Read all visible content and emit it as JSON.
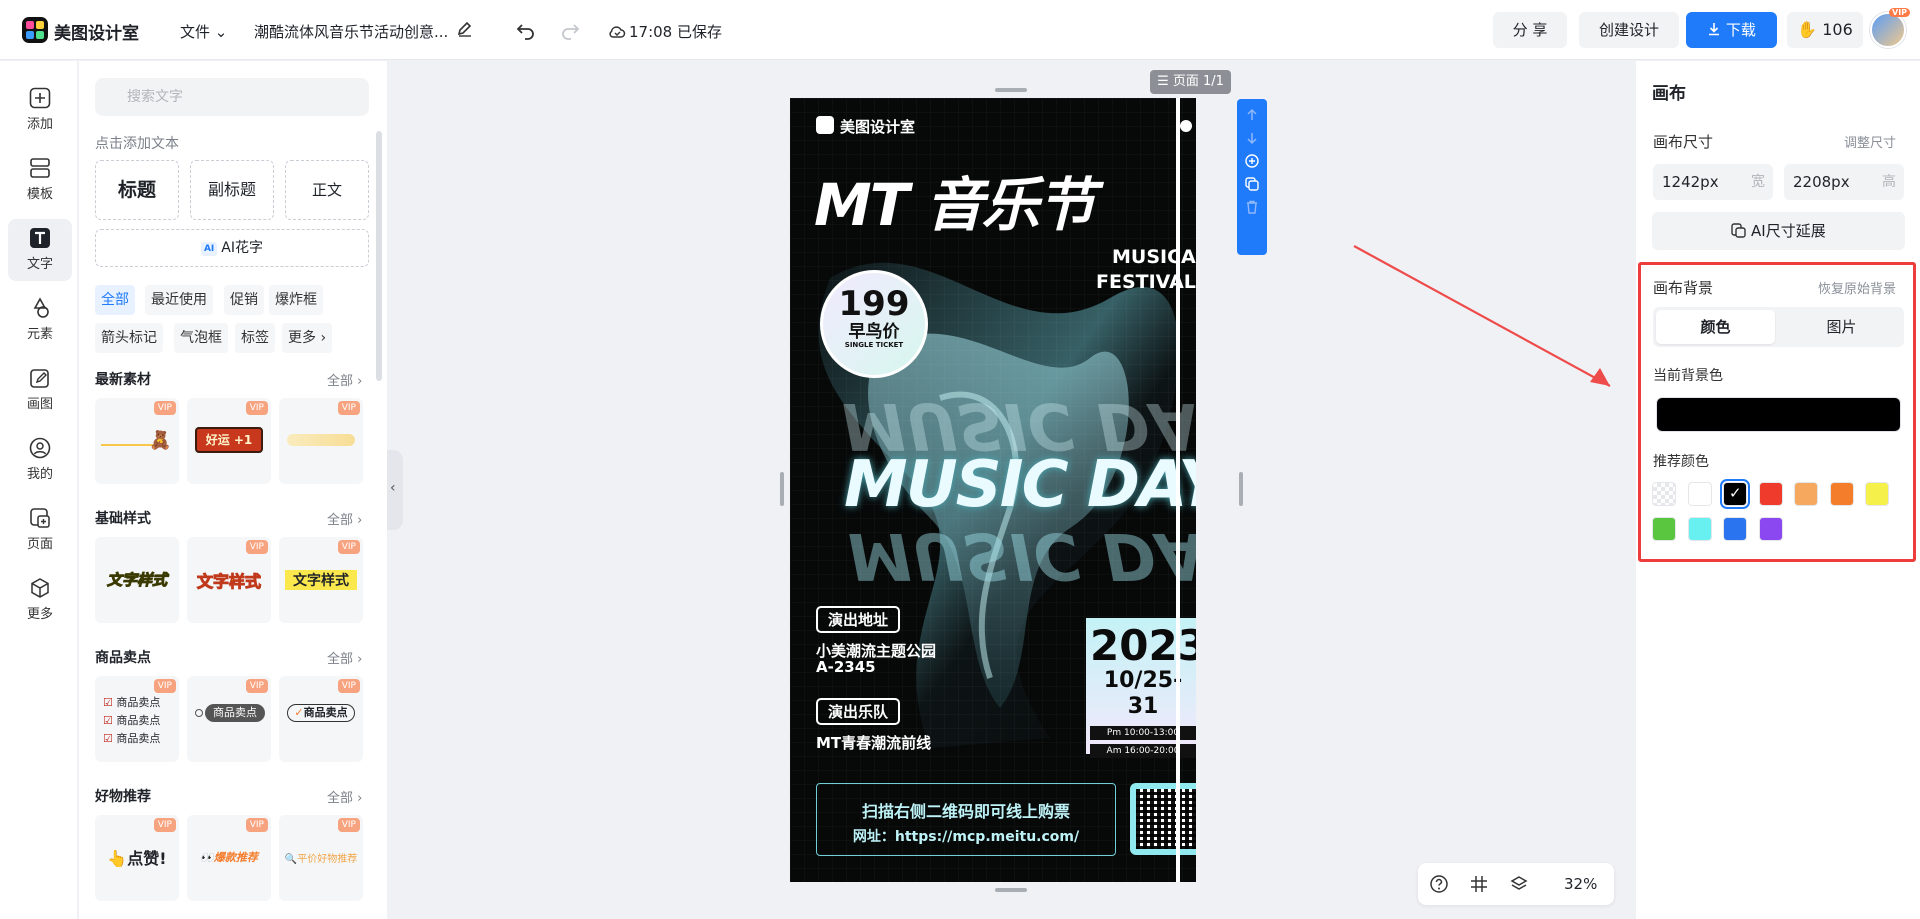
{
  "topbar": {
    "logo": "美图设计室",
    "file_menu": "文件",
    "doc_title": "潮酷流体风音乐节活动创意...",
    "save_status": "17:08 已保存",
    "share": "分 享",
    "create_design": "创建设计",
    "download": "下载",
    "coins": "106",
    "vip_badge": "VIP"
  },
  "rail": [
    {
      "label": "添加"
    },
    {
      "label": "模板"
    },
    {
      "label": "文字"
    },
    {
      "label": "元素"
    },
    {
      "label": "画图"
    },
    {
      "label": "我的"
    },
    {
      "label": "页面"
    },
    {
      "label": "更多"
    }
  ],
  "left_panel": {
    "search_placeholder": "搜索文字",
    "add_text_hint": "点击添加文本",
    "text_styles": [
      "标题",
      "副标题",
      "正文"
    ],
    "ai_button": "AI花字",
    "ai_tag": "AI",
    "chips": [
      "全部",
      "最近使用",
      "促销",
      "爆炸框",
      "箭头标记",
      "气泡框",
      "标签",
      "更多"
    ],
    "sections": [
      {
        "title": "最新素材",
        "all": "全部",
        "items": [
          "",
          "好运 +1",
          ""
        ]
      },
      {
        "title": "基础样式",
        "all": "全部",
        "items": [
          "文字样式",
          "文字样式",
          "文字样式"
        ]
      },
      {
        "title": "商品卖点",
        "all": "全部",
        "items": [
          "商品卖点",
          "商品卖点",
          "商品卖点"
        ]
      },
      {
        "title": "好物推荐",
        "all": "全部",
        "items": [
          "点赞!",
          "爆款推荐",
          "平价好物推荐"
        ]
      }
    ],
    "vip": "VIP"
  },
  "canvas": {
    "page_indicator": "页面 1/1",
    "zoom": "32%",
    "poster": {
      "brand": "美图设计室",
      "headline": "MT 音乐节",
      "musical": "MUSICAL",
      "festivals": "FESTIVALS",
      "price": "199",
      "early_bird": "早鸟价",
      "single_ticket": "SINGLE TICKET",
      "music_day": "MUSIC DAY",
      "venue_label": "演出地址",
      "venue_line1": "小美潮流主题公园",
      "venue_line2": "A-2345",
      "band_label": "演出乐队",
      "band_name": "MT青春潮流前线",
      "year": "2023",
      "dates": "10/25-31",
      "pm_time": "Pm 10:00-13:00",
      "am_time": "Am 16:00-20:00",
      "scan_text": "扫描右侧二维码即可线上购票",
      "url_text": "网址：https://mcp.meitu.com/"
    }
  },
  "right_panel": {
    "title": "画布",
    "size_label": "画布尺寸",
    "adjust_size": "调整尺寸",
    "width_value": "1242px",
    "width_unit": "宽",
    "height_value": "2208px",
    "height_unit": "高",
    "ai_extend": "AI尺寸延展",
    "bg_label": "画布背景",
    "restore_bg": "恢复原始背景",
    "tab_color": "颜色",
    "tab_image": "图片",
    "current_bg_label": "当前背景色",
    "current_bg_color": "#000000",
    "recommend_label": "推荐颜色",
    "swatches": [
      "transparent",
      "#ffffff",
      "#000000",
      "#ee3b2b",
      "#f6a85e",
      "#f47d2c",
      "#f6f14a",
      "#5ac63f",
      "#67f0ef",
      "#2a74f0",
      "#8b48f0"
    ]
  },
  "colors": {
    "accent": "#1f7bf9",
    "highlight": "#ee3b3b"
  }
}
